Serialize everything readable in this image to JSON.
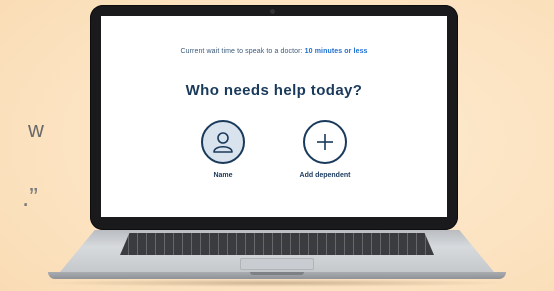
{
  "background": {
    "fragments": {
      "w": "w",
      "quote": ".”"
    }
  },
  "screen": {
    "wait_prefix": "Current wait time to speak to a doctor: ",
    "wait_value": "10 minutes or less",
    "question": "Who needs help today?",
    "options": [
      {
        "label": "Name",
        "icon": "user-icon"
      },
      {
        "label": "Add dependent",
        "icon": "plus-icon"
      }
    ]
  },
  "colors": {
    "background": "#fce3c1",
    "heading": "#1a3a5c",
    "accent": "#1f6fd0",
    "selected_fill": "#d9e3ee"
  }
}
